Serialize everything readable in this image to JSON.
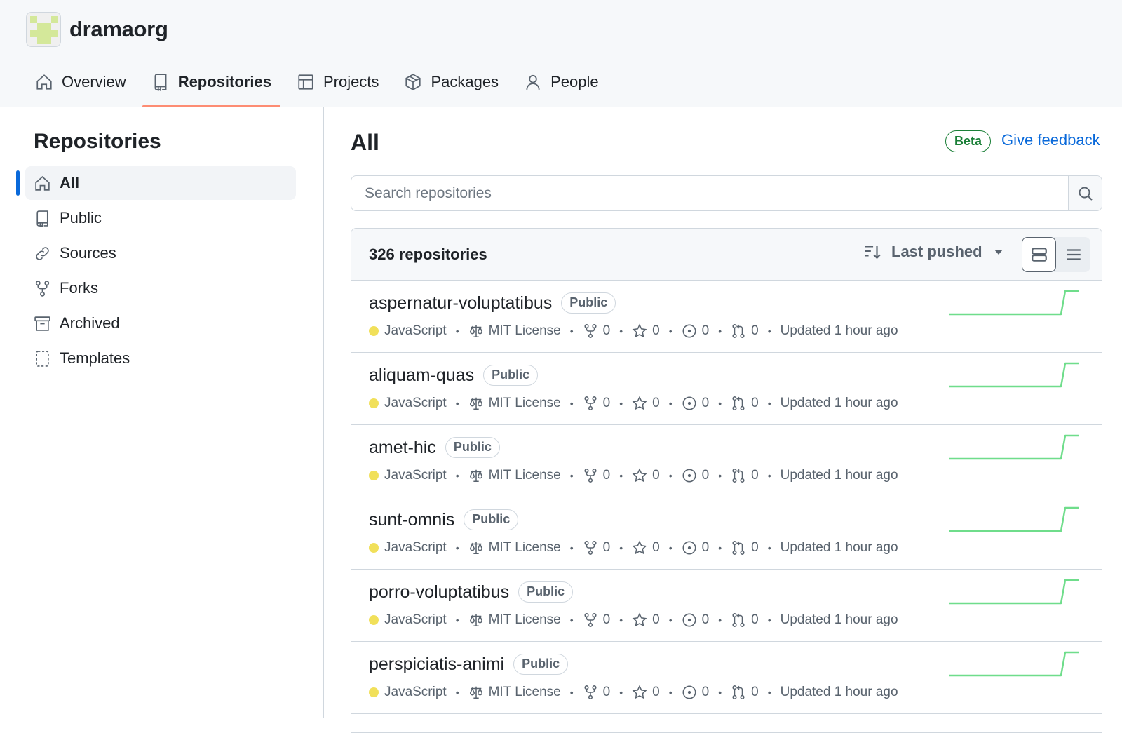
{
  "org": {
    "name": "dramaorg"
  },
  "tabs": [
    {
      "label": "Overview",
      "icon": "home-icon"
    },
    {
      "label": "Repositories",
      "icon": "repo-icon"
    },
    {
      "label": "Projects",
      "icon": "table-icon"
    },
    {
      "label": "Packages",
      "icon": "package-icon"
    },
    {
      "label": "People",
      "icon": "person-icon"
    }
  ],
  "sidebar": {
    "title": "Repositories",
    "items": [
      {
        "label": "All",
        "icon": "home-icon"
      },
      {
        "label": "Public",
        "icon": "repo-icon"
      },
      {
        "label": "Sources",
        "icon": "link-icon"
      },
      {
        "label": "Forks",
        "icon": "fork-icon"
      },
      {
        "label": "Archived",
        "icon": "archive-icon"
      },
      {
        "label": "Templates",
        "icon": "template-icon"
      }
    ]
  },
  "main": {
    "title": "All",
    "beta_label": "Beta",
    "feedback_label": "Give feedback",
    "search_placeholder": "Search repositories",
    "count_label": "326 repositories",
    "sort_label": "Last pushed"
  },
  "colors": {
    "javascript": "#f1e05a",
    "accent": "#0969da",
    "tab_underline": "#fd8c73",
    "spark": "#6fdd8b"
  },
  "repos": [
    {
      "name": "aspernatur-voluptatibus",
      "visibility": "Public",
      "language": "JavaScript",
      "license": "MIT License",
      "forks": "0",
      "stars": "0",
      "issues": "0",
      "pulls": "0",
      "updated": "Updated 1 hour ago"
    },
    {
      "name": "aliquam-quas",
      "visibility": "Public",
      "language": "JavaScript",
      "license": "MIT License",
      "forks": "0",
      "stars": "0",
      "issues": "0",
      "pulls": "0",
      "updated": "Updated 1 hour ago"
    },
    {
      "name": "amet-hic",
      "visibility": "Public",
      "language": "JavaScript",
      "license": "MIT License",
      "forks": "0",
      "stars": "0",
      "issues": "0",
      "pulls": "0",
      "updated": "Updated 1 hour ago"
    },
    {
      "name": "sunt-omnis",
      "visibility": "Public",
      "language": "JavaScript",
      "license": "MIT License",
      "forks": "0",
      "stars": "0",
      "issues": "0",
      "pulls": "0",
      "updated": "Updated 1 hour ago"
    },
    {
      "name": "porro-voluptatibus",
      "visibility": "Public",
      "language": "JavaScript",
      "license": "MIT License",
      "forks": "0",
      "stars": "0",
      "issues": "0",
      "pulls": "0",
      "updated": "Updated 1 hour ago"
    },
    {
      "name": "perspiciatis-animi",
      "visibility": "Public",
      "language": "JavaScript",
      "license": "MIT License",
      "forks": "0",
      "stars": "0",
      "issues": "0",
      "pulls": "0",
      "updated": "Updated 1 hour ago"
    }
  ]
}
